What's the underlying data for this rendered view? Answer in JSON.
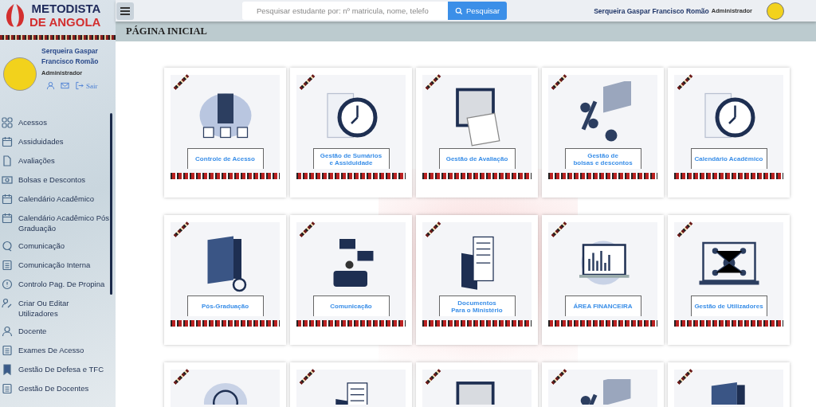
{
  "brand": {
    "line_1": "METODISTA",
    "line_2": "DE ANGOLA"
  },
  "user": {
    "name": "Serqueira Gaspar Francisco Romão",
    "role": "Administrador",
    "logout": "Sair"
  },
  "sidebar": {
    "items": [
      {
        "label": "Acessos"
      },
      {
        "label": "Assiduidades"
      },
      {
        "label": "Avaliações"
      },
      {
        "label": "Bolsas e Descontos"
      },
      {
        "label": "Calendário Acadêmico"
      },
      {
        "label": "Calendário Acadêmico Pós Graduação"
      },
      {
        "label": "Comunicação"
      },
      {
        "label": "Comunicação Interna"
      },
      {
        "label": "Controlo Pag. De Propina"
      },
      {
        "label": "Criar Ou Editar Utilizadores"
      },
      {
        "label": "Docente"
      },
      {
        "label": "Exames De Acesso"
      },
      {
        "label": "Gestão De Defesa e TFC"
      },
      {
        "label": "Gestão De Docentes"
      }
    ]
  },
  "search": {
    "placeholder": "Pesquisar estudante por: nº matricula, nome, telefo",
    "button": "Pesquisar"
  },
  "header_user": {
    "name": "Serqueira Gaspar Francisco Romão",
    "role": "Administrador"
  },
  "page_title": "PÁGINA INICIAL",
  "cards": [
    {
      "kind": "labeled",
      "label": "Controle de Acesso"
    },
    {
      "kind": "labeled",
      "label": "Gestão de Sumários\ne Assiduidade"
    },
    {
      "kind": "labeled",
      "label": "Gestão de Avaliação"
    },
    {
      "kind": "labeled",
      "label": "Gestão de\nbolsas e descontos"
    },
    {
      "kind": "labeled",
      "label": "Calendário Acadêmico"
    },
    {
      "kind": "labeled",
      "label": "Pós-Graduação"
    },
    {
      "kind": "labeled",
      "label": "Comunicação"
    },
    {
      "kind": "labeled",
      "label": "Documentos\nPara o Ministério"
    },
    {
      "kind": "labeled",
      "label": "ÁREA FINANCEIRA"
    },
    {
      "kind": "labeled",
      "label": "Gestão de Utilizadores"
    },
    {
      "kind": "cut-off"
    },
    {
      "kind": "cut-off"
    },
    {
      "kind": "cut-off"
    },
    {
      "kind": "cut-off"
    },
    {
      "kind": "cut-off"
    }
  ]
}
